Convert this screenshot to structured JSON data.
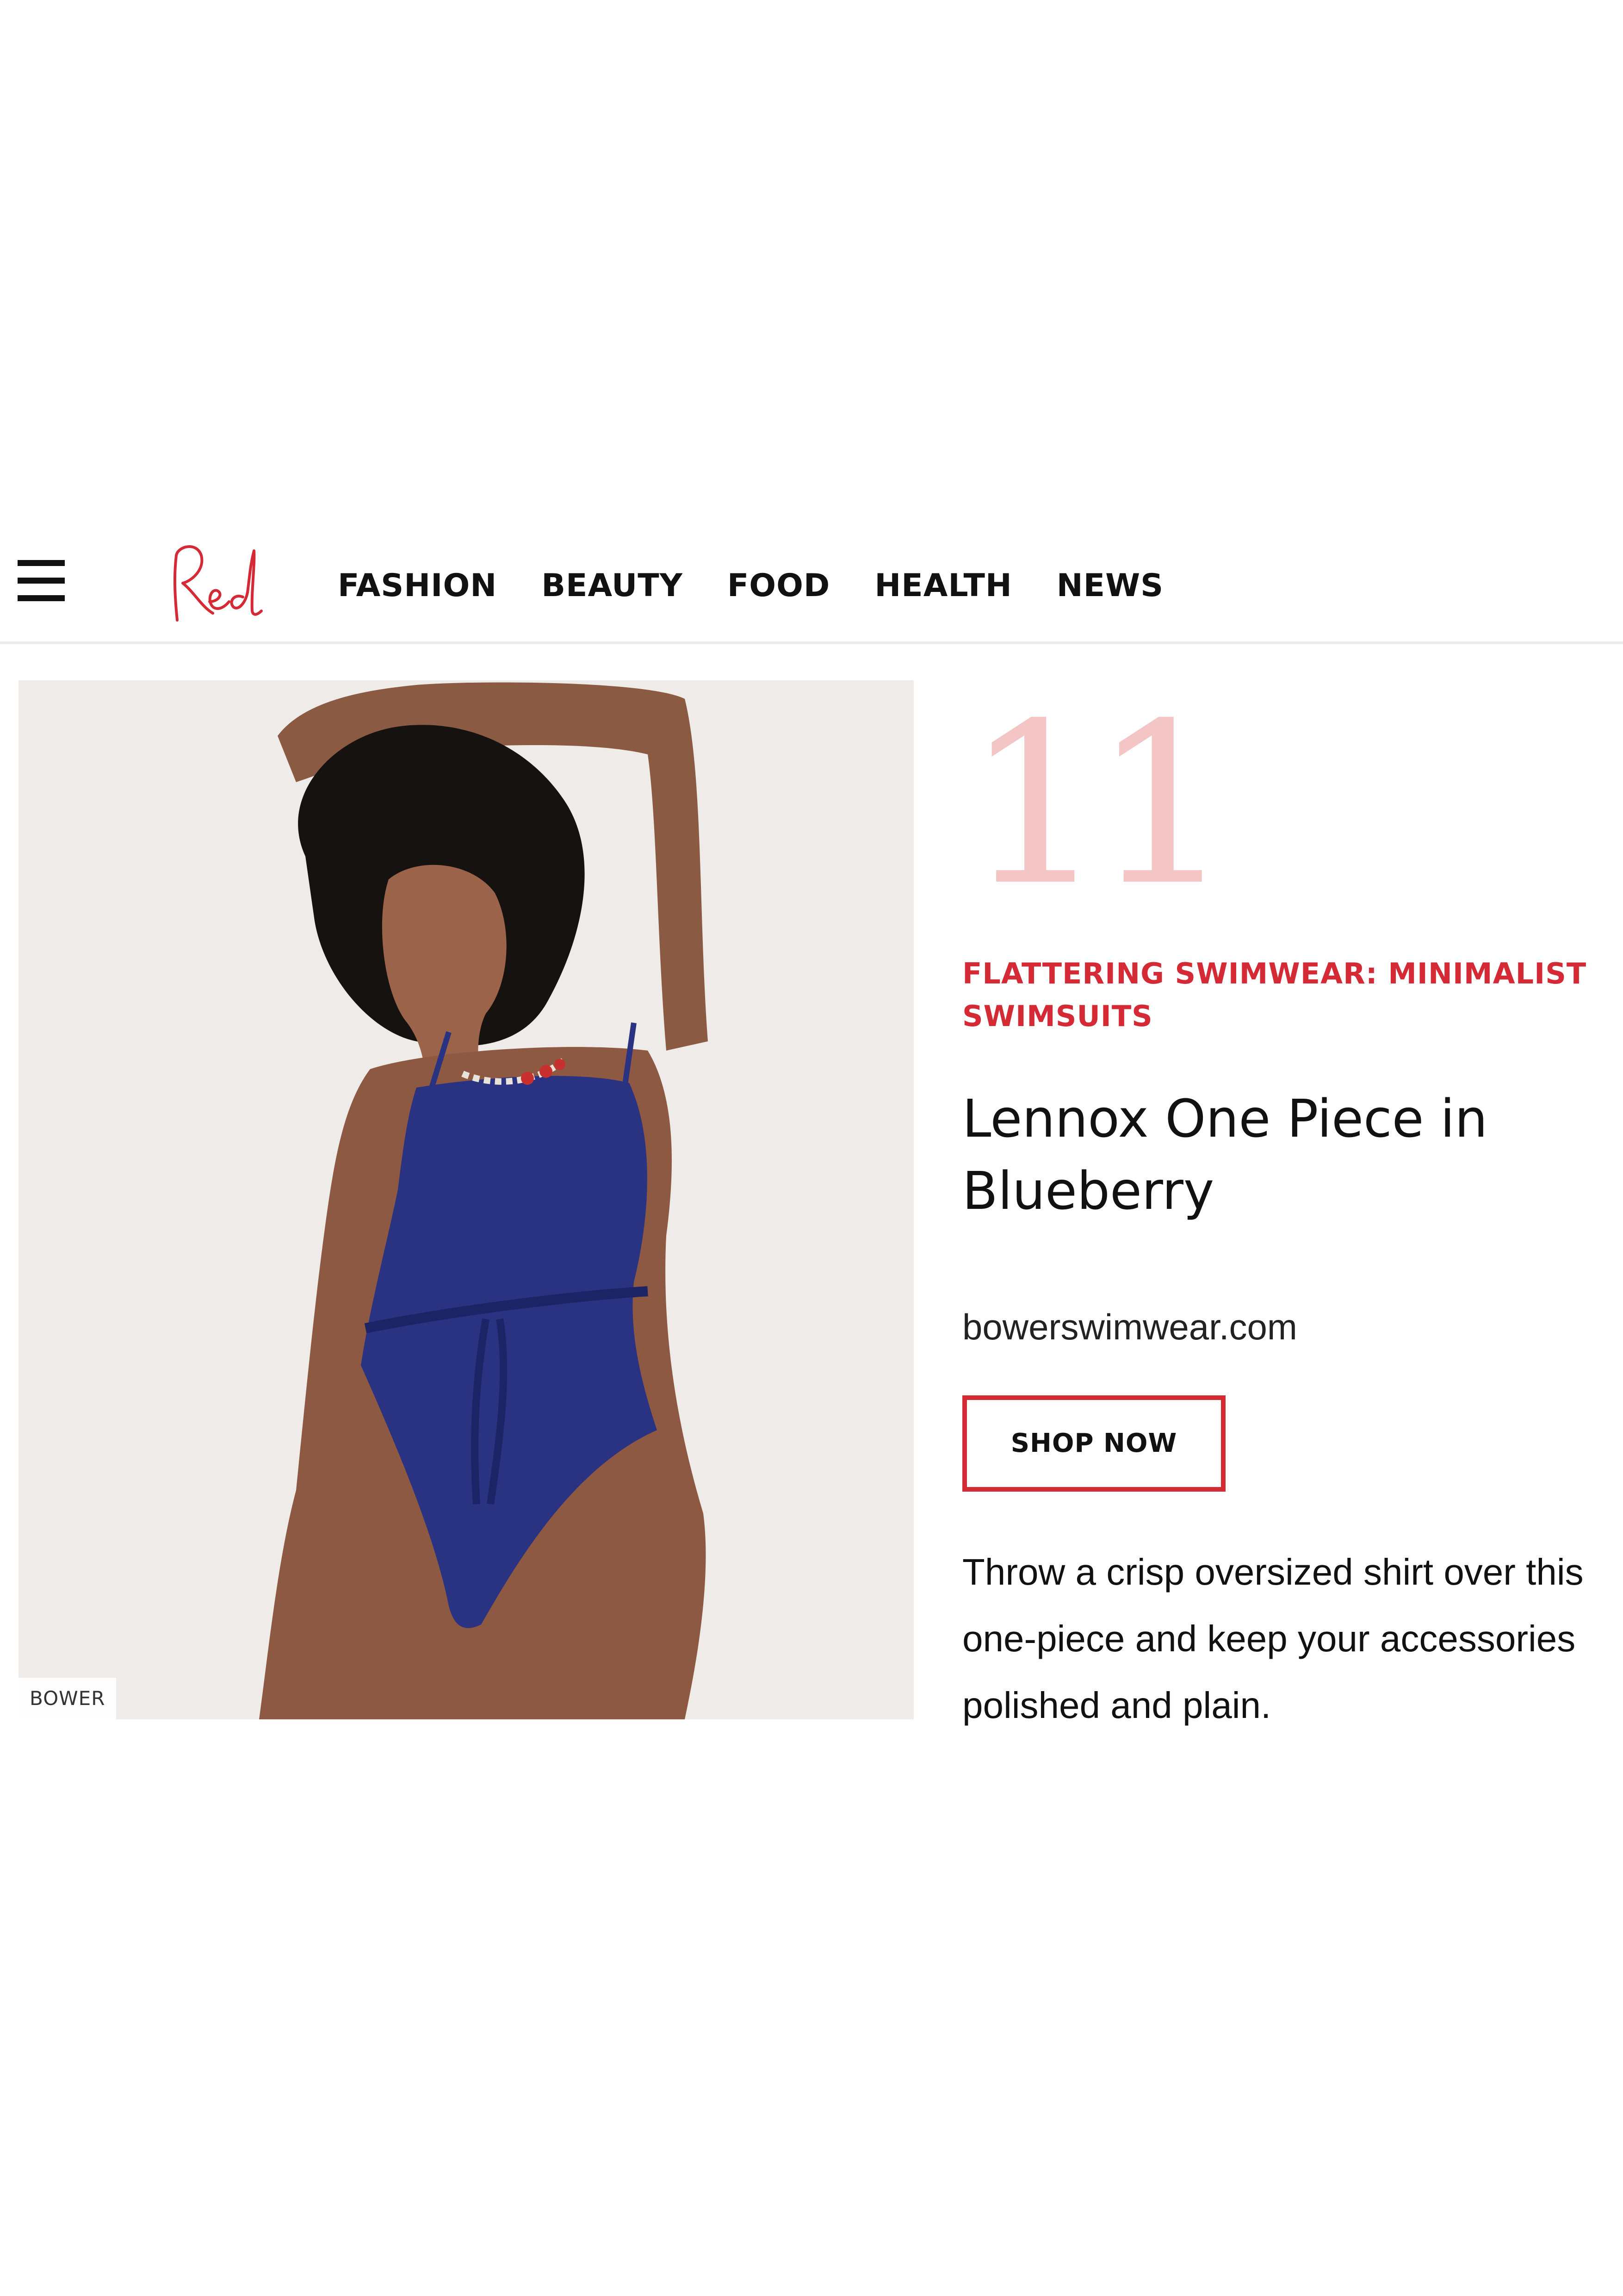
{
  "header": {
    "menu_icon": "hamburger-menu-icon",
    "logo_text": "Red",
    "nav": [
      "FASHION",
      "BEAUTY",
      "FOOD",
      "HEALTH",
      "NEWS"
    ]
  },
  "product": {
    "image_credit": "BOWER",
    "number": "11",
    "category": "FLATTERING SWIMWEAR: MINIMALIST SWIMSUITS",
    "title": "Lennox One Piece in Blueberry",
    "retailer": "bowerswimwear.com",
    "button_label": "SHOP NOW",
    "description": "Throw a crisp oversized shirt over this one-piece and keep your accessories polished and plain."
  },
  "colors": {
    "accent": "#d42a35",
    "number": "#f4c5c5",
    "swimsuit": "#2a3282"
  }
}
